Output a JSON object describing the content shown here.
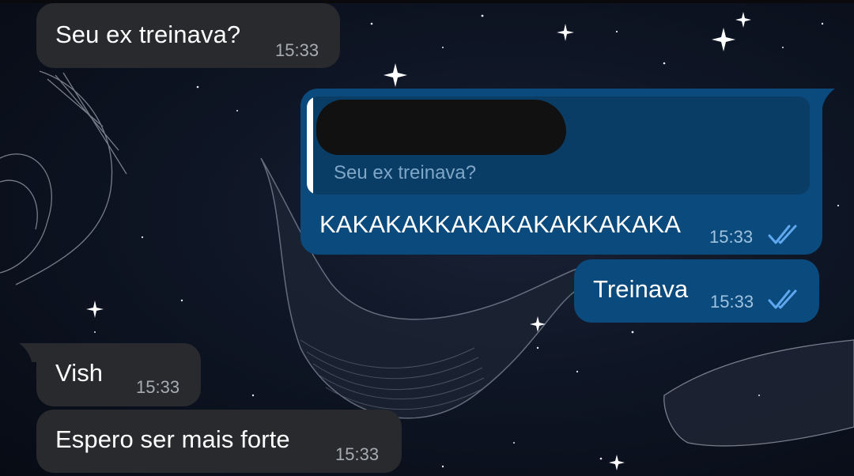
{
  "colors": {
    "incoming_bubble": "#282a2e",
    "outgoing_bubble": "#0b4a7c",
    "reply_block": "#0a3d66",
    "read_ticks": "#5fa8ef",
    "background": "#0b1220"
  },
  "messages": [
    {
      "direction": "incoming",
      "text": "Seu ex treinava?",
      "time": "15:33"
    },
    {
      "direction": "outgoing",
      "reply": {
        "author_redacted": true,
        "quoted_text": "Seu ex treinava?"
      },
      "text": "KAKAKAKKAKAKAKAKKAKAKA",
      "time": "15:33",
      "status_icon": "double-check-icon"
    },
    {
      "direction": "outgoing",
      "text": "Treinava",
      "time": "15:33",
      "status_icon": "double-check-icon"
    },
    {
      "direction": "incoming",
      "text": "Vish",
      "time": "15:33"
    },
    {
      "direction": "incoming",
      "text": "Espero ser mais forte",
      "time": "15:33"
    }
  ]
}
